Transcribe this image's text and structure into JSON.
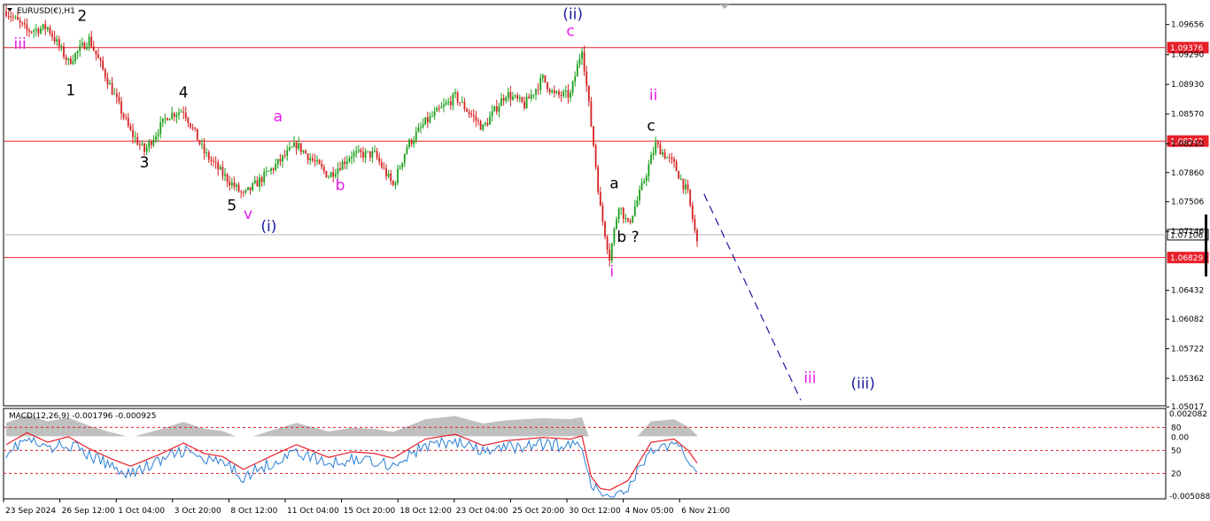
{
  "chart_data": {
    "type": "candlestick",
    "symbol_label": "EURUSD(€),H1",
    "price_axis": {
      "ylim": [
        1.0503,
        1.099
      ],
      "ticks": [
        "1.09656",
        "1.09290",
        "1.08930",
        "1.08570",
        "1.08210",
        "1.07860",
        "1.07506",
        "1.07146",
        "1.06432",
        "1.06082",
        "1.05722",
        "1.05362",
        "1.05017"
      ]
    },
    "horizontal_lines": [
      {
        "price": 1.09376,
        "label": "1.09376",
        "color": "#e8202a"
      },
      {
        "price": 1.08242,
        "label": "1.08242",
        "color": "#e8202a"
      },
      {
        "price": 1.06829,
        "label": "1.06829",
        "color": "#e8202a"
      },
      {
        "price": 1.07106,
        "label": "1.07106",
        "color": "#b8b8b8",
        "current": true
      }
    ],
    "time_axis": [
      "23 Sep 2024",
      "26 Sep 12:00",
      "1 Oct 04:00",
      "3 Oct 20:00",
      "8 Oct 12:00",
      "11 Oct 04:00",
      "15 Oct 20:00",
      "18 Oct 12:00",
      "23 Oct 04:00",
      "25 Oct 20:00",
      "30 Oct 12:00",
      "4 Nov 05:00",
      "6 Nov 21:00"
    ],
    "price_path": [
      [
        0,
        1.0982
      ],
      [
        9,
        1.0958
      ],
      [
        18,
        1.0962
      ],
      [
        27,
        1.092
      ],
      [
        36,
        1.0948
      ],
      [
        45,
        1.0892
      ],
      [
        54,
        1.0835
      ],
      [
        60,
        1.0812
      ],
      [
        70,
        1.0855
      ],
      [
        77,
        1.0862
      ],
      [
        86,
        1.081
      ],
      [
        94,
        1.0784
      ],
      [
        103,
        1.0758
      ],
      [
        116,
        1.0792
      ],
      [
        126,
        1.082
      ],
      [
        140,
        1.0782
      ],
      [
        150,
        1.0808
      ],
      [
        160,
        1.0808
      ],
      [
        168,
        1.077
      ],
      [
        174,
        1.0818
      ],
      [
        182,
        1.0847
      ],
      [
        195,
        1.0878
      ],
      [
        207,
        1.084
      ],
      [
        217,
        1.0882
      ],
      [
        225,
        1.0868
      ],
      [
        233,
        1.09
      ],
      [
        238,
        1.088
      ],
      [
        245,
        1.088
      ],
      [
        250,
        1.0938
      ],
      [
        255,
        1.082
      ],
      [
        258,
        1.0742
      ],
      [
        262,
        1.0683
      ],
      [
        266,
        1.0748
      ],
      [
        270,
        1.0722
      ],
      [
        275,
        1.076
      ],
      [
        282,
        1.082
      ],
      [
        290,
        1.0795
      ],
      [
        296,
        1.076
      ],
      [
        300,
        1.07
      ]
    ],
    "projection": {
      "from": [
        303,
        1.076
      ],
      "to": [
        345,
        1.051
      ],
      "style": "dashed",
      "color": "#1a1aa0"
    },
    "wave_labels": [
      {
        "text": "iii",
        "at": [
          6,
          1.0936
        ],
        "color": "#e619e6"
      },
      {
        "text": "2",
        "at": [
          33,
          1.097
        ],
        "color": "#000000"
      },
      {
        "text": "1",
        "at": [
          28,
          1.088
        ],
        "color": "#000000"
      },
      {
        "text": "4",
        "at": [
          77,
          1.0877
        ],
        "color": "#000000"
      },
      {
        "text": "3",
        "at": [
          60,
          1.0792
        ],
        "color": "#000000"
      },
      {
        "text": "a",
        "at": [
          118,
          1.0848
        ],
        "color": "#e619e6"
      },
      {
        "text": "b",
        "at": [
          145,
          1.0765
        ],
        "color": "#e619e6"
      },
      {
        "text": "5",
        "at": [
          98,
          1.074
        ],
        "color": "#000000"
      },
      {
        "text": "v",
        "at": [
          105,
          1.073
        ],
        "color": "#e619e6"
      },
      {
        "text": "(i)",
        "at": [
          114,
          1.0715
        ],
        "color": "#1a1aa0"
      },
      {
        "text": "(ii)",
        "at": [
          246,
          1.0972
        ],
        "color": "#1a1aa0"
      },
      {
        "text": "c",
        "at": [
          245,
          1.0952
        ],
        "color": "#e619e6"
      },
      {
        "text": "ii",
        "at": [
          281,
          1.0874
        ],
        "color": "#e619e6"
      },
      {
        "text": "c",
        "at": [
          280,
          1.0837
        ],
        "color": "#000000"
      },
      {
        "text": "a",
        "at": [
          264,
          1.0767
        ],
        "color": "#000000"
      },
      {
        "text": "b ?",
        "at": [
          270,
          1.0702
        ],
        "color": "#000000"
      },
      {
        "text": "i",
        "at": [
          263,
          1.066
        ],
        "color": "#e619e6"
      },
      {
        "text": "iii",
        "at": [
          349,
          1.0531
        ],
        "color": "#e619e6"
      },
      {
        "text": "(iii)",
        "at": [
          372,
          1.0524
        ],
        "color": "#1a1aa0"
      }
    ],
    "indicator": {
      "label": "MACD(12,26,9) -0.001796 -0.000925",
      "type": "macd",
      "ylim": [
        -0.0055,
        0.0024
      ],
      "ticks_right": [
        "0.002082",
        "-0.005088"
      ],
      "level_lines": [
        {
          "value": 80,
          "label": "80"
        },
        {
          "value": 50,
          "label": "50"
        },
        {
          "value": 20,
          "label": "20"
        }
      ],
      "zero_label": "0.00",
      "histogram_color": "#c0c0c0",
      "signal_color": "#e8202a",
      "osc_color": "#2a7fd6",
      "macd_path": [
        [
          0,
          0.0005
        ],
        [
          9,
          0.002
        ],
        [
          18,
          0.0008
        ],
        [
          27,
          0.0015
        ],
        [
          36,
          0.0
        ],
        [
          45,
          -0.0012
        ],
        [
          54,
          -0.0022
        ],
        [
          66,
          -0.0008
        ],
        [
          77,
          0.0007
        ],
        [
          86,
          -0.0006
        ],
        [
          94,
          -0.001
        ],
        [
          103,
          -0.0026
        ],
        [
          116,
          -0.0008
        ],
        [
          126,
          0.0005
        ],
        [
          140,
          -0.0011
        ],
        [
          150,
          -0.0004
        ],
        [
          160,
          -0.0006
        ],
        [
          168,
          -0.0012
        ],
        [
          182,
          0.0012
        ],
        [
          195,
          0.0018
        ],
        [
          207,
          0.0004
        ],
        [
          217,
          0.001
        ],
        [
          233,
          0.0014
        ],
        [
          245,
          0.0012
        ],
        [
          250,
          0.0016
        ],
        [
          254,
          -0.0035
        ],
        [
          258,
          -0.005
        ],
        [
          262,
          -0.0052
        ],
        [
          270,
          -0.004
        ],
        [
          280,
          0.0008
        ],
        [
          290,
          0.0012
        ],
        [
          296,
          -0.0002
        ],
        [
          300,
          -0.0018
        ]
      ]
    }
  }
}
